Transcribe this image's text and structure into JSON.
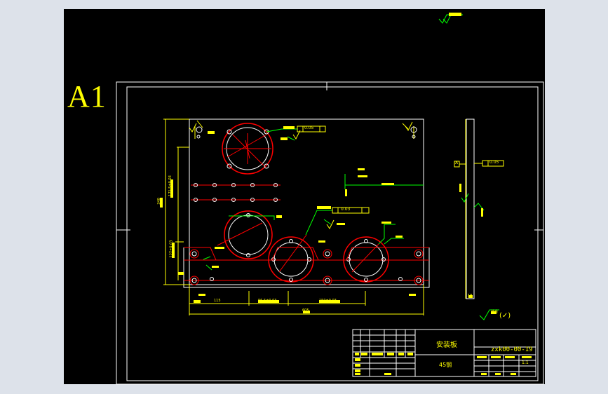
{
  "sheet": {
    "size_label": "A1"
  },
  "title_block": {
    "part_name": "安装板",
    "material": "45钢",
    "drawing_number": "zxk00-00-19",
    "scale": "1:1"
  },
  "annotations": {
    "surface_finish_general": "其余",
    "surface_finish_symbol": "(✓)",
    "datum_label": "A",
    "tolerance_frame_top": "0.05",
    "tolerance_frame_side": "0.05",
    "tolerance_frame_mid": "0.03"
  },
  "dimensions": {
    "overall_width": "605",
    "overall_height": "340",
    "left_offset": "115",
    "hole_spacing_1": "96.5±0.03",
    "hole_spacing_2": "150±0.03",
    "vertical_1": "171.5±0.03",
    "vertical_2": "127±0.03",
    "thickness": "18"
  },
  "colors": {
    "background": "#000000",
    "frame": "#ffffff",
    "dimension": "#ffff00",
    "outline": "#ffffff",
    "circles": "#ff0000",
    "centerline": "#ff0000",
    "leader": "#00ff00",
    "title_text": "#ffff00"
  }
}
